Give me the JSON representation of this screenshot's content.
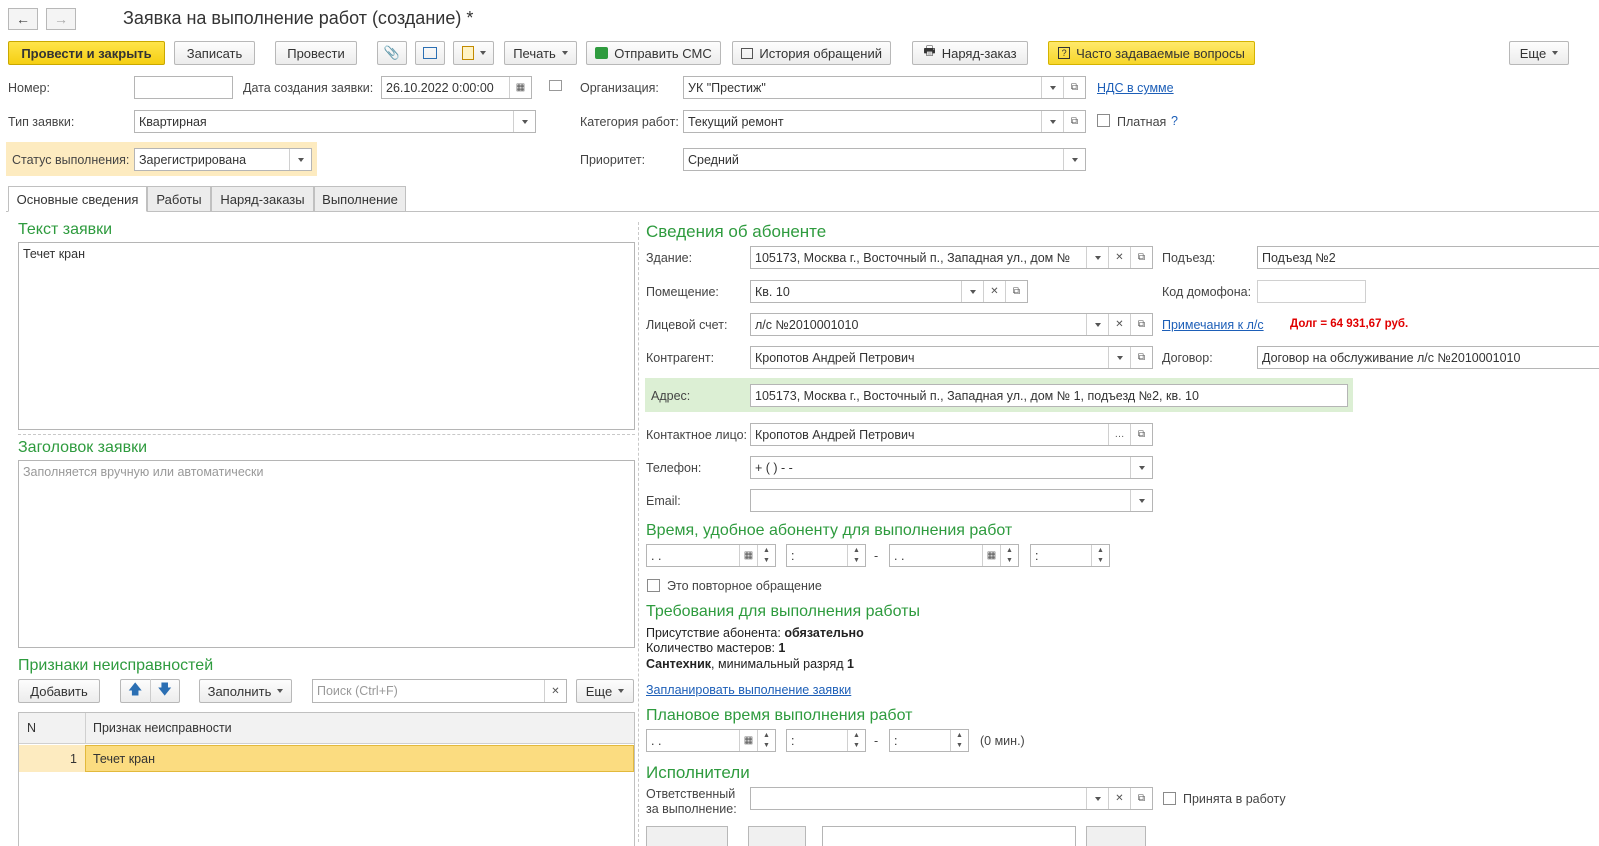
{
  "window": {
    "title": "Заявка на выполнение работ (создание) *"
  },
  "toolbar": {
    "post_close": "Провести и закрыть",
    "save": "Записать",
    "post": "Провести",
    "print": "Печать",
    "send_sms": "Отправить СМС",
    "history": "История обращений",
    "work_order": "Наряд-заказ",
    "faq": "Часто задаваемые вопросы",
    "more": "Еще"
  },
  "header": {
    "number_label": "Номер:",
    "number_value": "",
    "date_label": "Дата создания заявки:",
    "date_value": "26.10.2022  0:00:00",
    "org_label": "Организация:",
    "org_value": "УК \"Престиж\"",
    "vat_link": "НДС в сумме",
    "type_label": "Тип заявки:",
    "type_value": "Квартирная",
    "category_label": "Категория работ:",
    "category_value": "Текущий ремонт",
    "paid_label": "Платная",
    "help": "?",
    "status_label": "Статус выполнения:",
    "status_value": "Зарегистрирована",
    "priority_label": "Приоритет:",
    "priority_value": "Средний"
  },
  "tabs": [
    "Основные сведения",
    "Работы",
    "Наряд-заказы",
    "Выполнение"
  ],
  "left": {
    "request_text_title": "Текст заявки",
    "request_text_value": "Течет кран",
    "request_header_title": "Заголовок заявки",
    "request_header_placeholder": "Заполняется вручную или автоматически",
    "faults_title": "Признаки неисправностей",
    "add_btn": "Добавить",
    "fill_btn": "Заполнить",
    "search_placeholder": "Поиск (Ctrl+F)",
    "more_btn": "Еще",
    "table_headers": [
      "N",
      "Признак неисправности"
    ],
    "table_rows": [
      {
        "n": "1",
        "sign": "Течет кран"
      }
    ]
  },
  "right": {
    "subscriber_title": "Сведения об абоненте",
    "building_label": "Здание:",
    "building_value": "105173, Москва г., Восточный п., Западная ул., дом №",
    "entrance_label": "Подъезд:",
    "entrance_value": "Подъезд №2",
    "room_label": "Помещение:",
    "room_value": "Кв. 10",
    "intercom_label": "Код домофона:",
    "intercom_value": "",
    "account_label": "Лицевой счет:",
    "account_value": "л/с №2010001010",
    "account_notes_link": "Примечания к л/с",
    "debt": "Долг = 64 931,67 руб.",
    "contractor_label": "Контрагент:",
    "contractor_value": "Кропотов Андрей Петрович",
    "contract_label": "Договор:",
    "contract_value": "Договор на обслуживание л/с №2010001010",
    "address_label": "Адрес:",
    "address_value": "105173, Москва г., Восточный п., Западная ул., дом № 1, подъезд №2, кв. 10",
    "contact_label": "Контактное лицо:",
    "contact_value": "Кропотов Андрей Петрович",
    "phone_label": "Телефон:",
    "phone_value": "+ (   )   -  -",
    "email_label": "Email:",
    "email_value": "",
    "time_title": "Время, удобное абоненту для выполнения работ",
    "date_mask": " .  .",
    "time_mask": "  :",
    "dash": "-",
    "repeat_label": "Это повторное обращение",
    "req_title": "Требования для выполнения работы",
    "req_presence_label": "Присутствие абонента: ",
    "req_presence_value": "обязательно",
    "req_masters_label": "Количество мастеров: ",
    "req_masters_value": "1",
    "req_plumber": "Сантехник",
    "req_rank_label": ", минимальный разряд ",
    "req_rank_value": "1",
    "plan_link": "Запланировать выполнение заявки",
    "planned_title": "Плановое время выполнения работ",
    "planned_minutes": "(0 мин.)",
    "executors_title": "Исполнители",
    "responsible_label_1": "Ответственный",
    "responsible_label_2": "за выполнение:",
    "responsible_value": "",
    "accepted_label": "Принята в работу"
  },
  "colors": {
    "accent_green": "#2e9b3e",
    "primary_yellow": "#f5cf12",
    "status_bg": "#fdebc0",
    "address_bg": "#dcefd4",
    "link": "#1d5fb8",
    "debt_red": "#e00000"
  }
}
